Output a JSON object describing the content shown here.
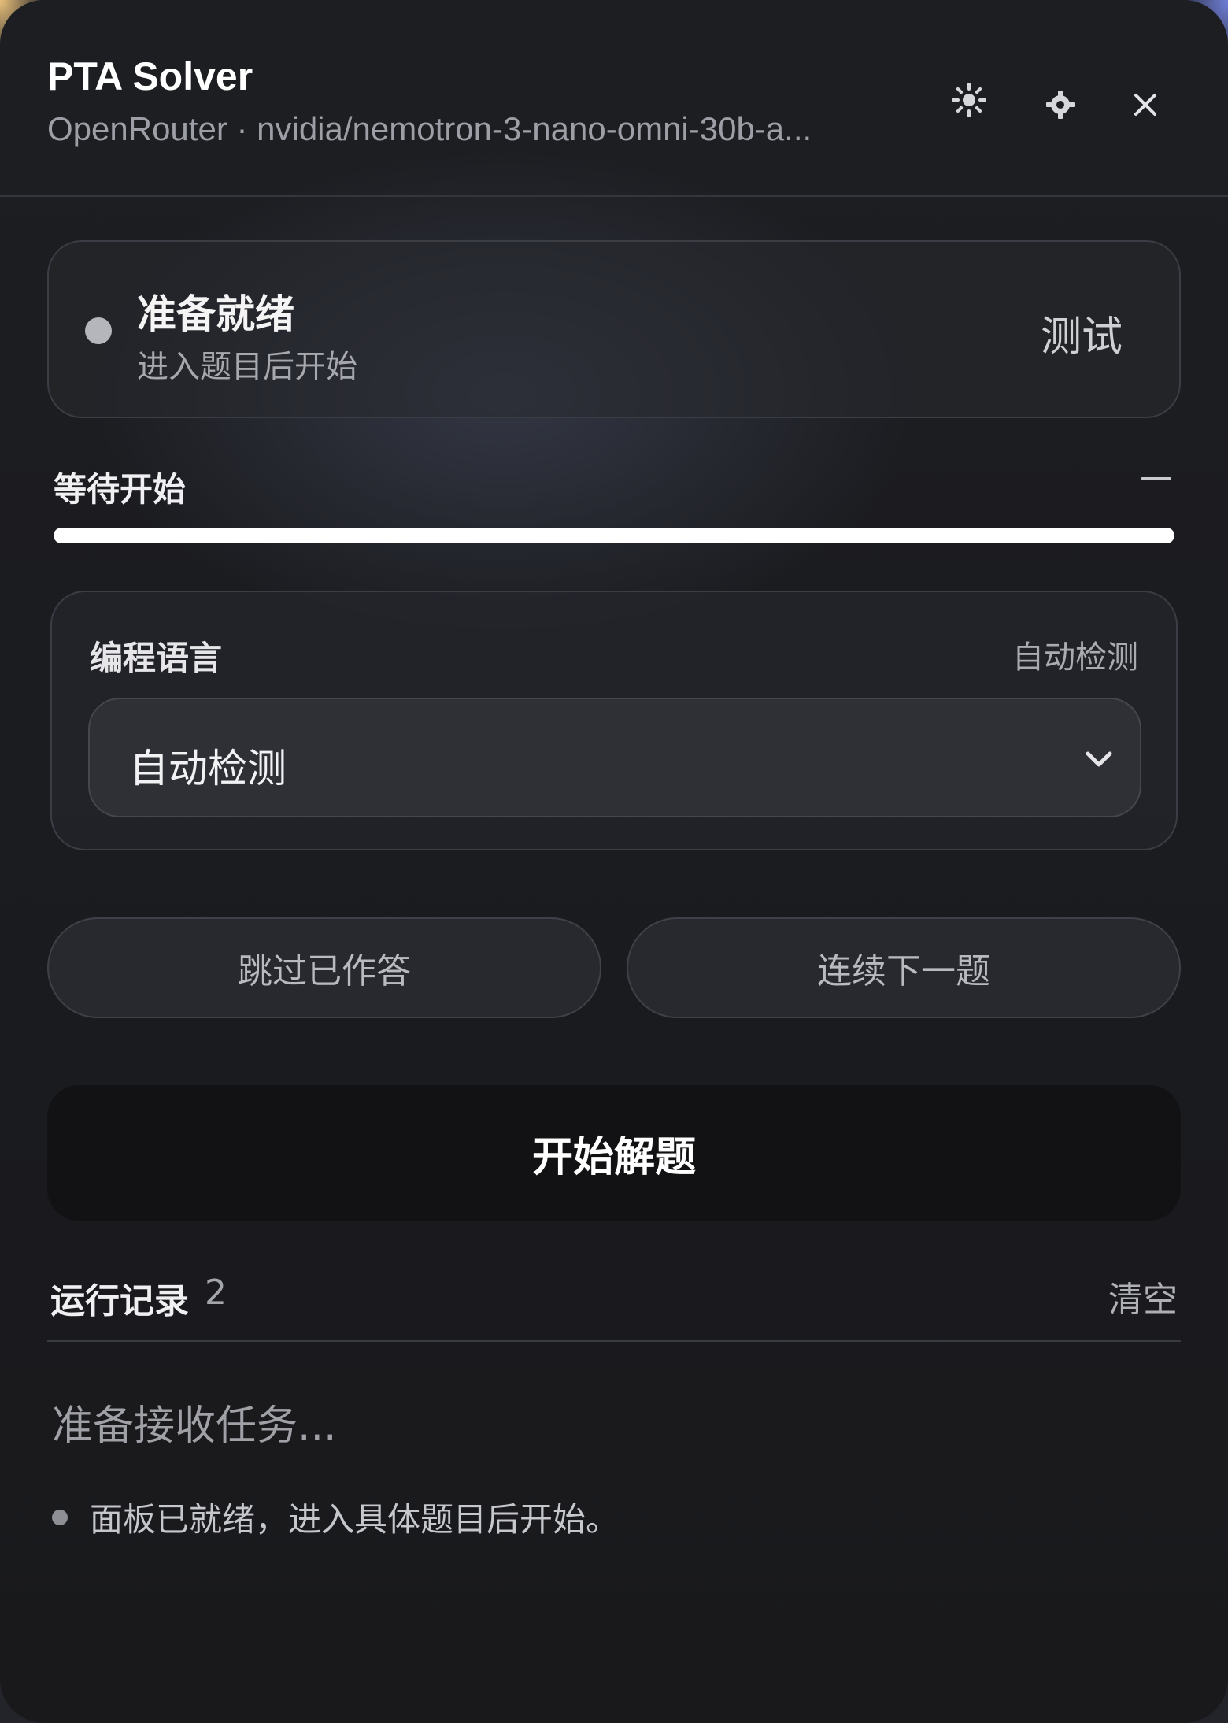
{
  "header": {
    "title": "PTA Solver",
    "subtitle": "OpenRouter · nvidia/nemotron-3-nano-omni-30b-a...",
    "icons": [
      "sun-icon",
      "gear-icon",
      "close-icon"
    ]
  },
  "status_card": {
    "title": "准备就绪",
    "subtitle": "进入题目后开始",
    "test_label": "测试",
    "dot_color": "#b5b6bb"
  },
  "progress": {
    "label": "等待开始",
    "value_text": "—",
    "fill_percent": 100
  },
  "language": {
    "label": "编程语言",
    "hint": "自动检测",
    "selected": "自动检测"
  },
  "actions": {
    "skip_label": "跳过已作答",
    "next_label": "连续下一题",
    "start_label": "开始解题"
  },
  "log": {
    "title": "运行记录",
    "count": "2",
    "clear_label": "清空",
    "status": "准备接收任务...",
    "entries": [
      {
        "text": "面板已就绪，进入具体题目后开始。"
      }
    ]
  },
  "colors": {
    "background": "#1d1e22",
    "accent": "#ffffff",
    "start_button": "#121214"
  }
}
